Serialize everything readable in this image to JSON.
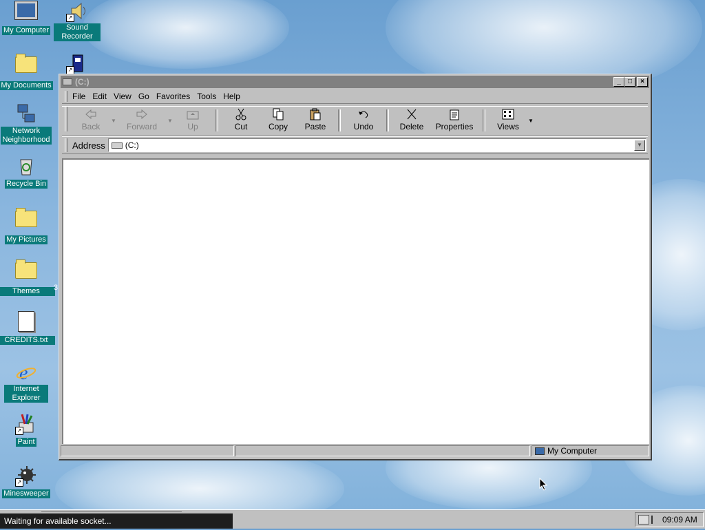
{
  "desktop": {
    "icons": [
      {
        "label": "My Computer"
      },
      {
        "label": "Sound Recorder"
      },
      {
        "label": "My Documents"
      },
      {
        "label": "Network Neighborhood"
      },
      {
        "label": "Recycle Bin"
      },
      {
        "label": "My Pictures"
      },
      {
        "label": "Themes"
      },
      {
        "label": "CREDITS.txt"
      },
      {
        "label": "Internet Explorer"
      },
      {
        "label": "Paint"
      },
      {
        "label": "Minesweeper"
      }
    ],
    "themes_suffix": "3"
  },
  "window": {
    "title": "(C:)",
    "menu": [
      "File",
      "Edit",
      "View",
      "Go",
      "Favorites",
      "Tools",
      "Help"
    ],
    "toolbar": {
      "back": "Back",
      "forward": "Forward",
      "up": "Up",
      "cut": "Cut",
      "copy": "Copy",
      "paste": "Paste",
      "undo": "Undo",
      "delete": "Delete",
      "properties": "Properties",
      "views": "Views"
    },
    "address": {
      "label": "Address",
      "value": "(C:)"
    },
    "status": {
      "location": "My Computer"
    }
  },
  "taskbar": {
    "tooltip": "Waiting for available socket...",
    "clock": "09:09 AM"
  }
}
